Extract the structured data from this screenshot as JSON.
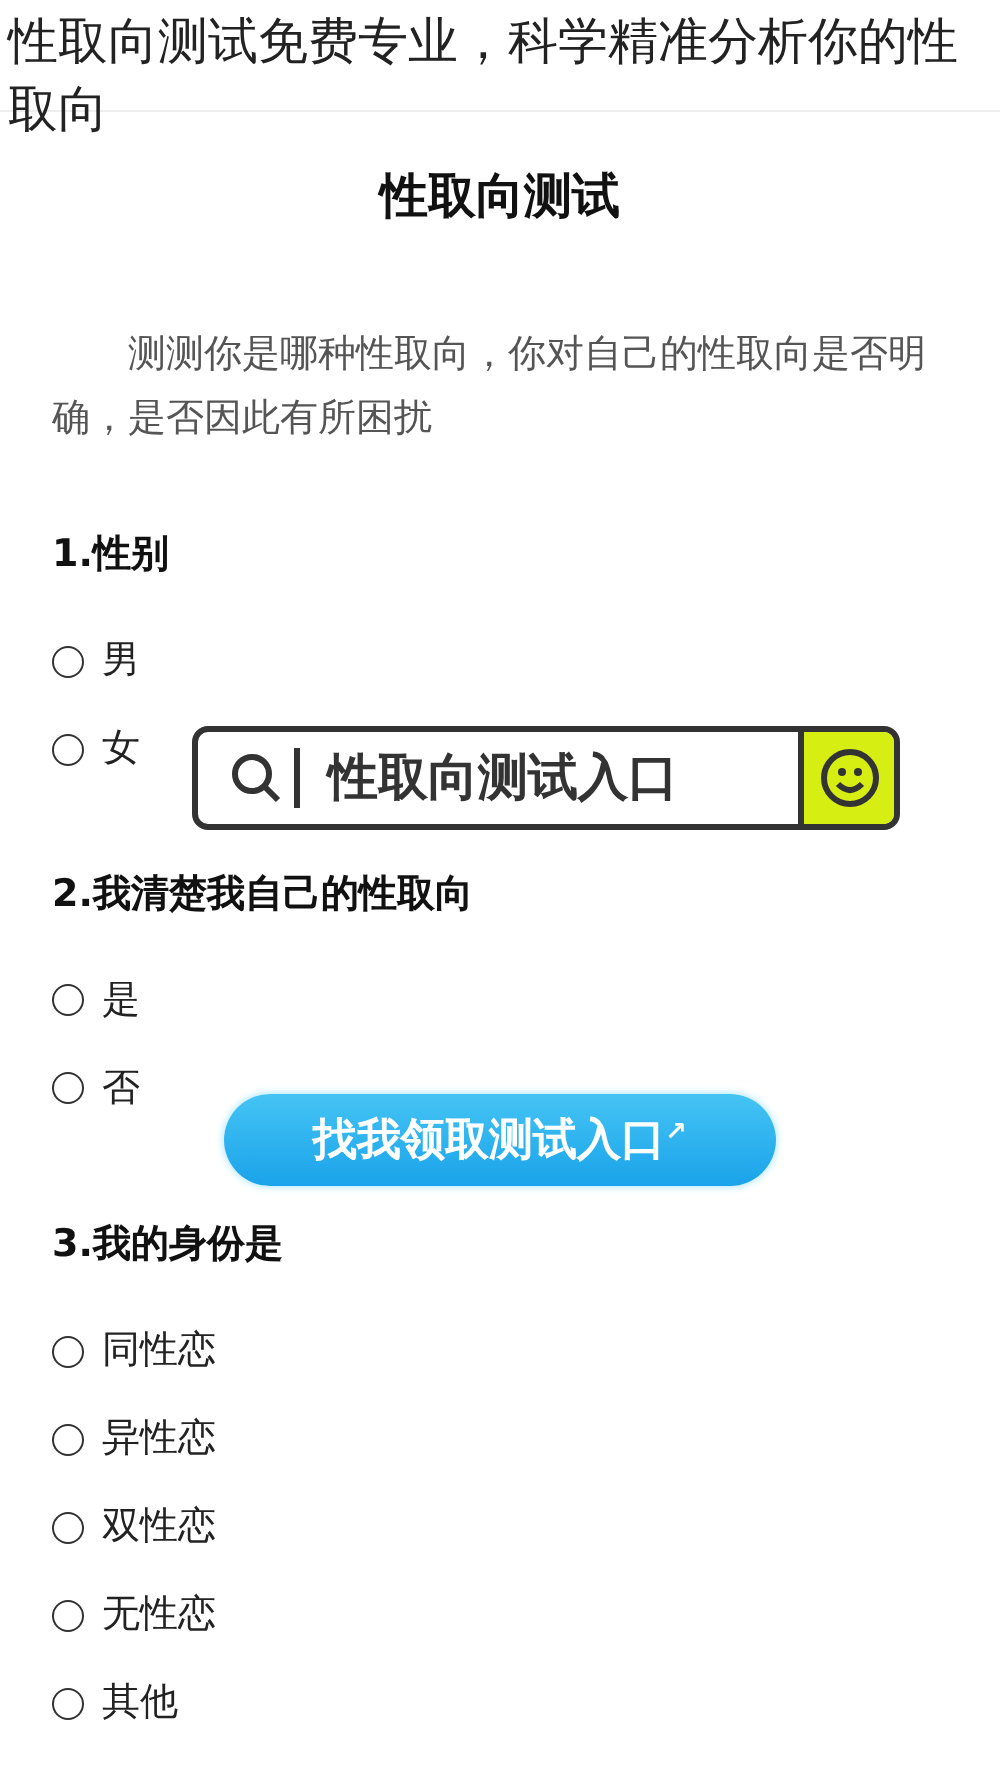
{
  "headline": "性取向测试免费专业，科学精准分析你的性取向",
  "page_title": "性取向测试",
  "intro": "测测你是哪种性取向，你对自己的性取向是否明确，是否因此有所困扰",
  "questions": [
    {
      "title": "1.性别",
      "options": [
        {
          "label": "男",
          "selected": false
        },
        {
          "label": "女",
          "selected": false
        }
      ]
    },
    {
      "title": "2.我清楚我自己的性取向",
      "options": [
        {
          "label": "是",
          "selected": false
        },
        {
          "label": "否",
          "selected": false
        }
      ]
    },
    {
      "title": "3.我的身份是",
      "options": [
        {
          "label": "同性恋",
          "selected": false
        },
        {
          "label": "异性恋",
          "selected": false
        },
        {
          "label": "双性恋",
          "selected": false
        },
        {
          "label": "无性恋",
          "selected": false
        },
        {
          "label": "其他",
          "selected": false
        }
      ]
    }
  ],
  "search_banner": {
    "text": "性取向测试入口"
  },
  "cta_button": {
    "label": "找我领取测试入口",
    "mark": "↗"
  }
}
